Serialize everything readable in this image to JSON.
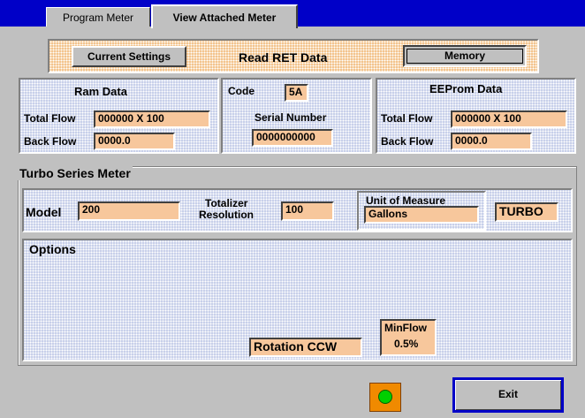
{
  "tabs": [
    {
      "label": "Program Meter"
    },
    {
      "label": "View Attached Meter"
    }
  ],
  "top_bar": {
    "current_settings_label": "Current Settings",
    "read_ret_label": "Read RET Data",
    "memory_label": "Memory"
  },
  "ram": {
    "title": "Ram Data",
    "total_flow_label": "Total Flow",
    "total_flow_value": "000000 X 100",
    "back_flow_label": "Back Flow",
    "back_flow_value": "0000.0"
  },
  "code": {
    "label": "Code",
    "value": "5A",
    "serial_label": "Serial Number",
    "serial_value": "0000000000"
  },
  "eeprom": {
    "title": "EEProm Data",
    "total_flow_label": "Total Flow",
    "total_flow_value": "000000 X 100",
    "back_flow_label": "Back Flow",
    "back_flow_value": "0000.0"
  },
  "meter": {
    "group_title": "Turbo Series Meter",
    "model_label": "Model",
    "model_value": "200",
    "totalizer_label_1": "Totalizer",
    "totalizer_label_2": "Resolution",
    "totalizer_value": "100",
    "uom_label": "Unit of Measure",
    "uom_value": "Gallons",
    "type_value": "TURBO"
  },
  "options": {
    "title": "Options",
    "rotation_value": "Rotation CCW",
    "minflow_label": "MinFlow",
    "minflow_value": "0.5%"
  },
  "footer": {
    "status_color": "#00d000",
    "exit_label": "Exit"
  }
}
